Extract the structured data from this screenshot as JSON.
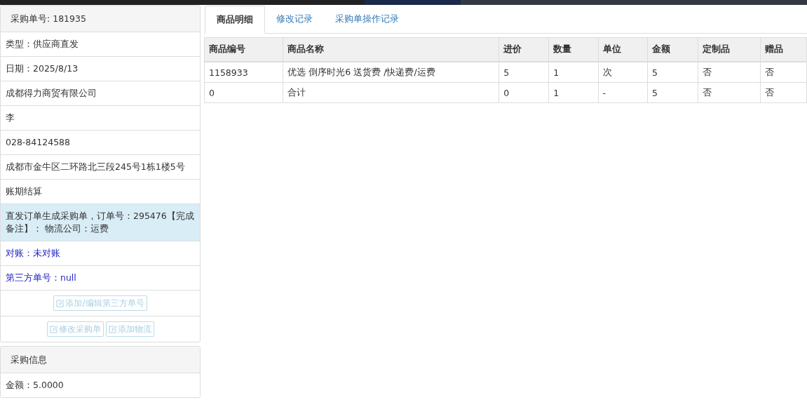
{
  "order_panel": {
    "title": "采购单号: 181935",
    "rows": [
      {
        "kind": "plain",
        "text": "类型：供应商直发"
      },
      {
        "kind": "plain",
        "text": "日期：2025/8/13"
      },
      {
        "kind": "plain",
        "text": "成都得力商贸有限公司"
      },
      {
        "kind": "plain",
        "text": "李"
      },
      {
        "kind": "plain",
        "text": "028-84124588"
      },
      {
        "kind": "plain",
        "text": "成都市金牛区二环路北三段245号1栋1楼5号"
      },
      {
        "kind": "plain",
        "text": "账期结算"
      },
      {
        "kind": "highlight",
        "text": "直发订单生成采购单，订单号：295476【完成备注】： 物流公司：运费"
      },
      {
        "kind": "link",
        "text": "对账：未对账"
      },
      {
        "kind": "link",
        "text": "第三方单号：null"
      }
    ],
    "button_rows": [
      [
        "添加/编辑第三方单号"
      ],
      [
        "修改采购单",
        "添加物流"
      ]
    ]
  },
  "purchase_panel": {
    "title": "采购信息",
    "rows": [
      "金额：5.0000"
    ]
  },
  "tabs": [
    {
      "label": "商品明细",
      "selected": true
    },
    {
      "label": "修改记录",
      "selected": false
    },
    {
      "label": "采购单操作记录",
      "selected": false
    }
  ],
  "table": {
    "columns": [
      "商品编号",
      "商品名称",
      "进价",
      "数量",
      "单位",
      "金额",
      "定制品",
      "赠品"
    ],
    "rows": [
      [
        "1158933",
        "优选 倒序时光6 送货费 /快递费/运费",
        "5",
        "1",
        "次",
        "5",
        "否",
        "否"
      ],
      [
        "0",
        "合计",
        "0",
        "1",
        "-",
        "5",
        "否",
        "否"
      ]
    ]
  }
}
